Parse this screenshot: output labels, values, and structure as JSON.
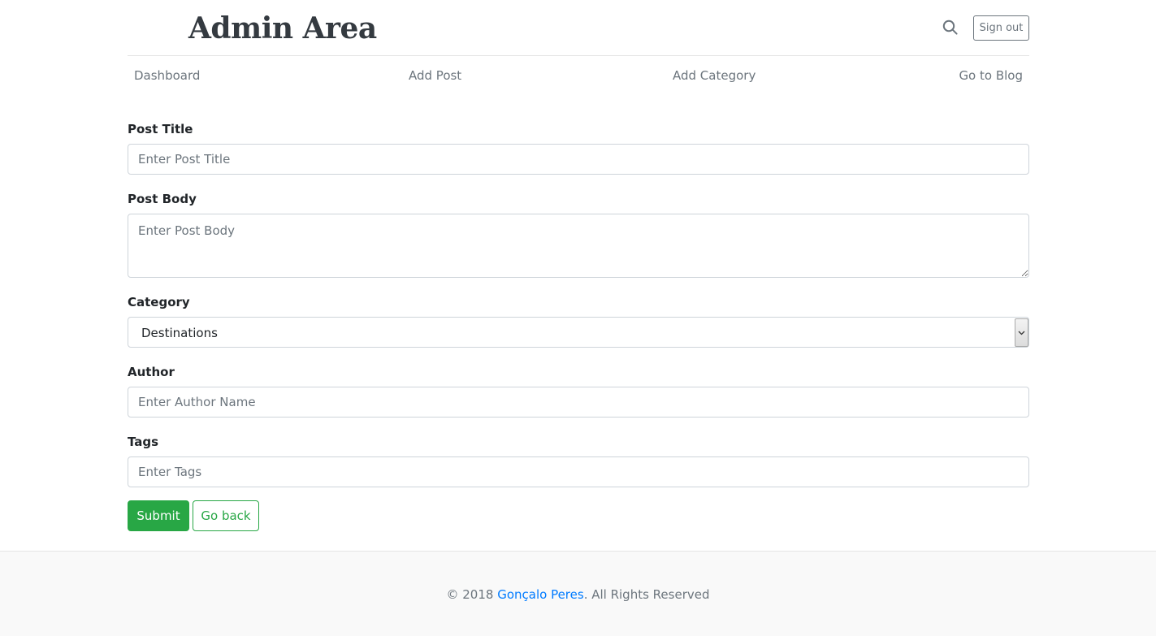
{
  "header": {
    "brand": "Admin Area",
    "search_icon": "search-icon",
    "signout_label": "Sign out"
  },
  "nav": {
    "items": [
      {
        "label": "Dashboard"
      },
      {
        "label": "Add Post"
      },
      {
        "label": "Add Category"
      },
      {
        "label": "Go to Blog"
      }
    ]
  },
  "form": {
    "title": {
      "label": "Post Title",
      "placeholder": "Enter Post Title",
      "value": ""
    },
    "body": {
      "label": "Post Body",
      "placeholder": "Enter Post Body",
      "value": ""
    },
    "category": {
      "label": "Category",
      "selected": "Destinations"
    },
    "author": {
      "label": "Author",
      "placeholder": "Enter Author Name",
      "value": ""
    },
    "tags": {
      "label": "Tags",
      "placeholder": "Enter Tags",
      "value": ""
    },
    "submit_label": "Submit",
    "back_label": "Go back"
  },
  "footer": {
    "prefix": "© 2018 ",
    "author_link": "Gonçalo Peres",
    "suffix": ". All Rights Reserved"
  },
  "colors": {
    "accent_green": "#28a745",
    "link_blue": "#007bff",
    "muted": "#6c757d"
  }
}
